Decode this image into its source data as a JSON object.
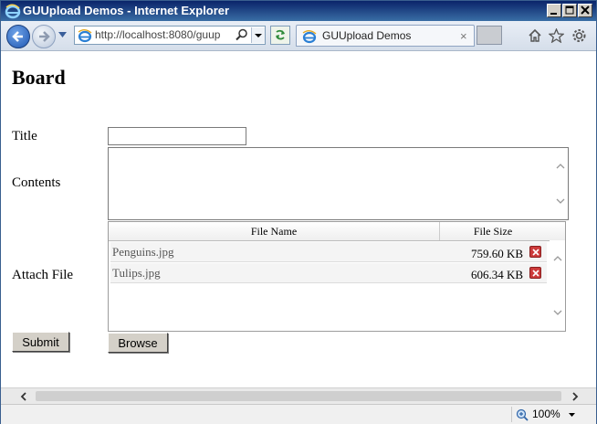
{
  "window": {
    "title": "GUUpload Demos - Internet Explorer"
  },
  "address": {
    "url": "http://localhost:8080/guup"
  },
  "tab": {
    "label": "GUUpload Demos",
    "close": "×"
  },
  "page": {
    "heading": "Board",
    "title_label": "Title",
    "title_value": "",
    "contents_label": "Contents",
    "contents_value": "",
    "attach_label": "Attach File",
    "columns": {
      "name": "File Name",
      "size": "File Size"
    },
    "files": [
      {
        "name": "Penguins.jpg",
        "size": "759.60 KB"
      },
      {
        "name": "Tulips.jpg",
        "size": "606.34 KB"
      }
    ],
    "submit_label": "Submit",
    "browse_label": "Browse"
  },
  "status": {
    "zoom": "100%"
  }
}
